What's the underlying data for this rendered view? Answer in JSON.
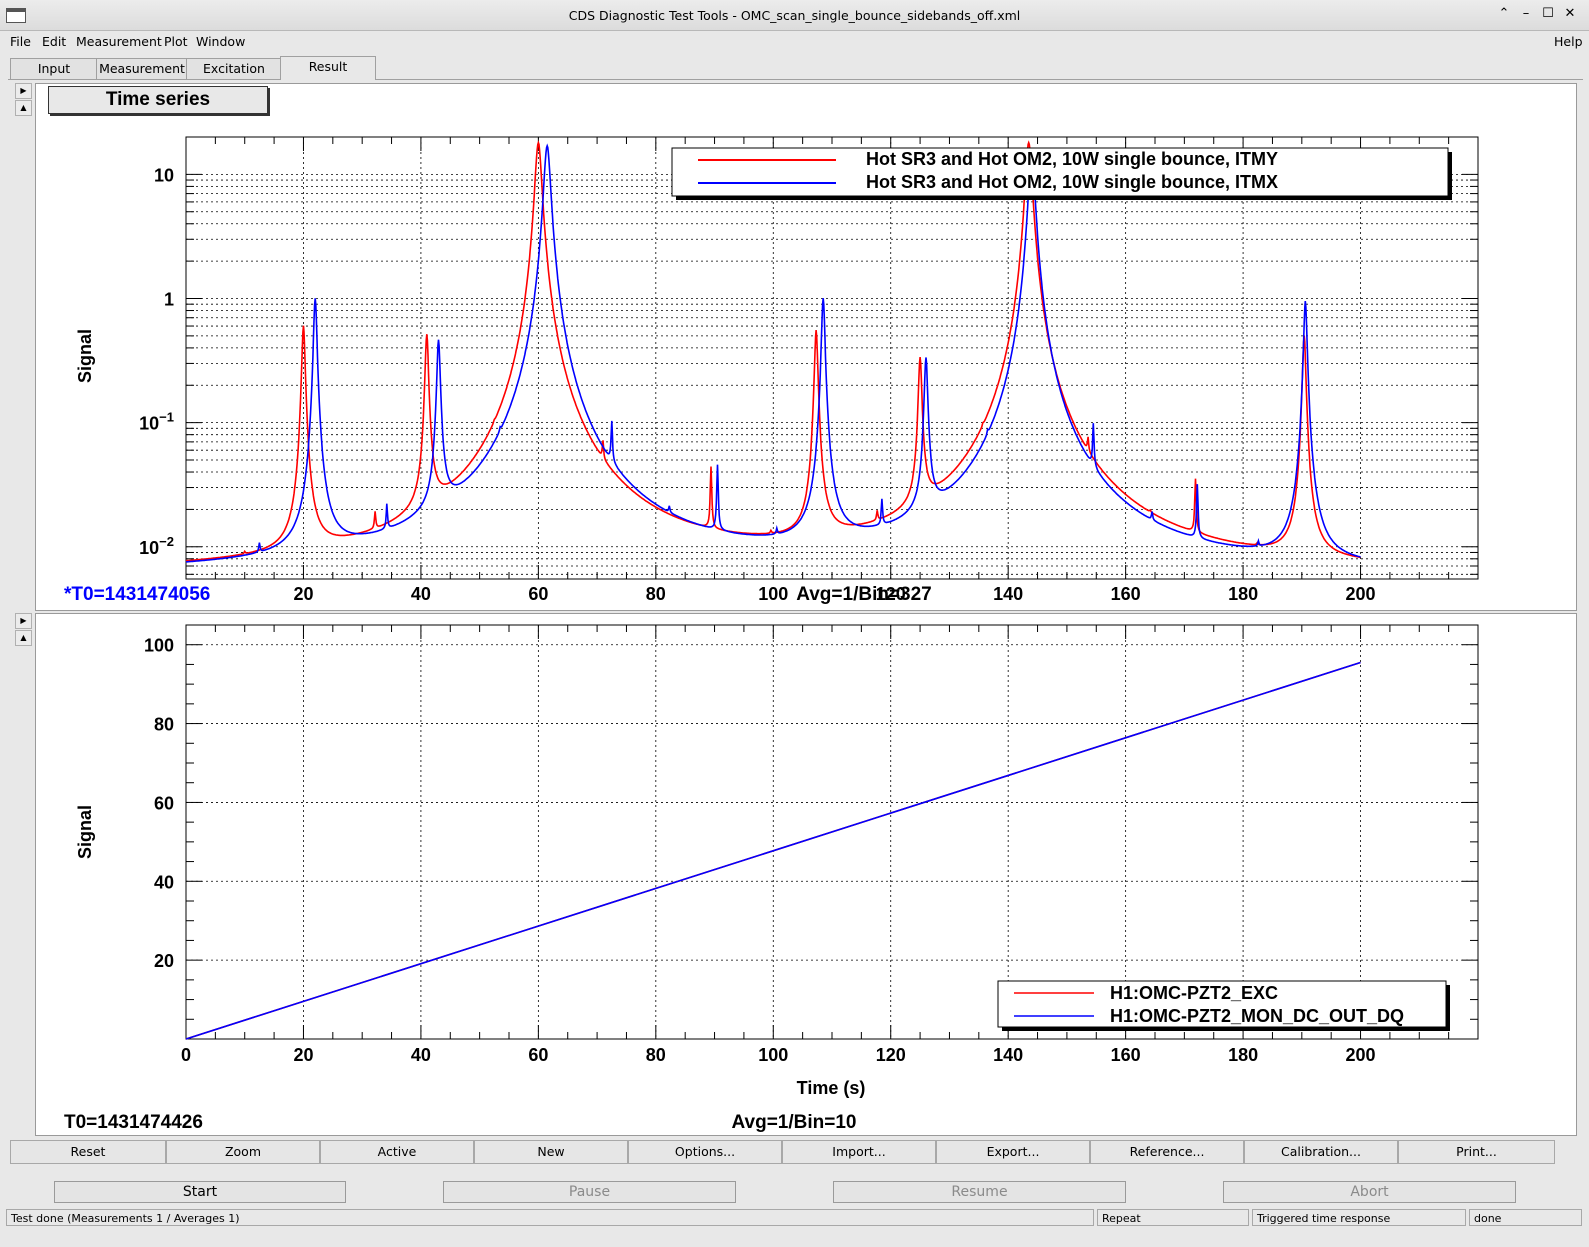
{
  "window": {
    "title": "CDS Diagnostic Test Tools - OMC_scan_single_bounce_sidebands_off.xml",
    "controls": [
      "⌃",
      "–",
      "☐",
      "✕"
    ]
  },
  "menu": {
    "file": "File",
    "edit": "Edit",
    "measurement": "Measurement",
    "plot": "Plot",
    "window": "Window",
    "help": "Help"
  },
  "tabs": [
    "Input",
    "Measurement",
    "Excitation",
    "Result"
  ],
  "active_tab": "Result",
  "top_plot": {
    "panel_label": "Time series",
    "footer_t0": "*T0=1431474056",
    "footer_avg": "Avg=1/Bin=327"
  },
  "bottom_plot": {
    "footer_t0": "T0=1431474426",
    "footer_avg": "Avg=1/Bin=10"
  },
  "chart_data": [
    {
      "type": "line",
      "ylabel": "Signal",
      "xlabel": "",
      "yscale": "log",
      "xlim": [
        0,
        220
      ],
      "ylim": [
        0.0055,
        20
      ],
      "xticks": [
        20,
        40,
        60,
        80,
        100,
        120,
        140,
        160,
        180,
        200
      ],
      "ytick_labels": [
        "10",
        "1",
        "10^−1",
        "10^−2"
      ],
      "grid": true,
      "legend": "top-right",
      "baseline": 0.0058,
      "series": [
        {
          "name": "Hot SR3 and Hot OM2, 10W single bounce, ITMY",
          "color": "#ff0000",
          "peaks": [
            [
              10,
              0.0062
            ],
            [
              20,
              0.6
            ],
            [
              32.2,
              0.011
            ],
            [
              41,
              0.5
            ],
            [
              52.5,
              0.009
            ],
            [
              60,
              18
            ],
            [
              71,
              0.026
            ],
            [
              89.4,
              0.036
            ],
            [
              99.6,
              0.0065
            ],
            [
              107.3,
              0.55
            ],
            [
              117.7,
              0.009
            ],
            [
              125,
              0.32
            ],
            [
              135.7,
              0.01
            ],
            [
              143.5,
              18
            ],
            [
              153.6,
              0.023
            ],
            [
              164.2,
              0.0065
            ],
            [
              171.9,
              0.028
            ],
            [
              182.4,
              0.0062
            ],
            [
              190.4,
              0.5
            ]
          ]
        },
        {
          "name": "Hot SR3 and Hot OM2, 10W single bounce, ITMX",
          "color": "#0000ff",
          "peaks": [
            [
              12.5,
              0.0075
            ],
            [
              22,
              1.0
            ],
            [
              34.2,
              0.014
            ],
            [
              43,
              0.45
            ],
            [
              53.5,
              0.012
            ],
            [
              61.5,
              17
            ],
            [
              72.5,
              0.06
            ],
            [
              82.3,
              0.0082
            ],
            [
              90.5,
              0.038
            ],
            [
              100.6,
              0.0072
            ],
            [
              108.5,
              1.0
            ],
            [
              118.5,
              0.015
            ],
            [
              126,
              0.32
            ],
            [
              136.5,
              0.012
            ],
            [
              144,
              14
            ],
            [
              154.5,
              0.06
            ],
            [
              164.5,
              0.0085
            ],
            [
              172.2,
              0.026
            ],
            [
              182.6,
              0.0068
            ],
            [
              190.6,
              0.95
            ]
          ]
        }
      ]
    },
    {
      "type": "line",
      "ylabel": "Signal",
      "xlabel": "Time (s)",
      "xlim": [
        0,
        220
      ],
      "ylim": [
        0,
        105
      ],
      "xticks": [
        0,
        20,
        40,
        60,
        80,
        100,
        120,
        140,
        160,
        180,
        200
      ],
      "yticks": [
        20,
        40,
        60,
        80,
        100
      ],
      "grid": true,
      "legend": "bottom-right",
      "series": [
        {
          "name": "H1:OMC-PZT2_EXC",
          "color": "#ff0000",
          "x": [
            0,
            200
          ],
          "y": [
            0,
            95.5
          ]
        },
        {
          "name": "H1:OMC-PZT2_MON_DC_OUT_DQ",
          "color": "#0000ff",
          "x": [
            0,
            200
          ],
          "y": [
            0,
            95.5
          ]
        }
      ]
    }
  ],
  "buttons": [
    "Reset",
    "Zoom",
    "Active",
    "New",
    "Options...",
    "Import...",
    "Export...",
    "Reference...",
    "Calibration...",
    "Print..."
  ],
  "controls": {
    "start": "Start",
    "pause": "Pause",
    "resume": "Resume",
    "abort": "Abort"
  },
  "status": {
    "main": "Test done (Measurements 1 / Averages 1)",
    "mode": "Repeat",
    "type": "Triggered time response",
    "state": "done"
  }
}
